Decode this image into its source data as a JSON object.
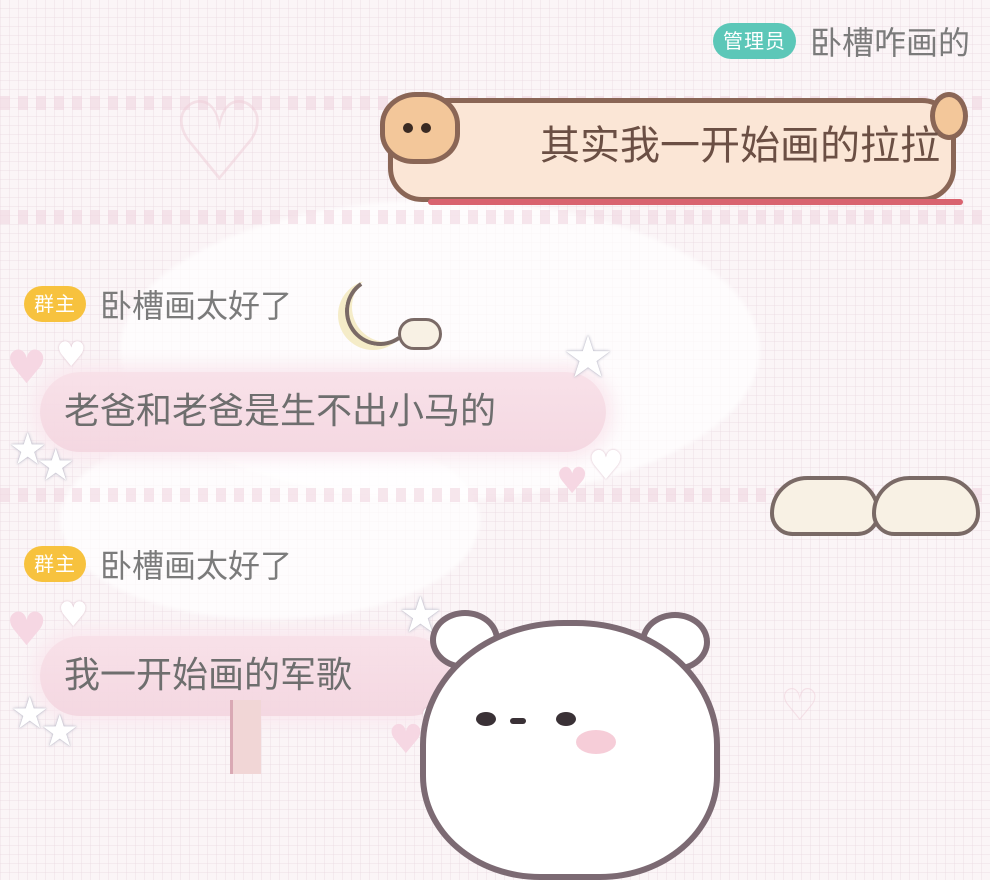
{
  "messages": [
    {
      "side": "right",
      "badge": "管理员",
      "sender": "卧槽咋画的",
      "text": "其实我一开始画的拉拉"
    },
    {
      "side": "left",
      "badge": "群主",
      "sender": "卧槽画太好了",
      "text": "老爸和老爸是生不出小马的"
    },
    {
      "side": "left",
      "badge": "群主",
      "sender": "卧槽画太好了",
      "text": "我一开始画的军歌"
    }
  ],
  "colors": {
    "admin_badge": "#5cc7b8",
    "owner_badge": "#f7c23e",
    "right_bubble": "#fbe6d6",
    "left_bubble": "#f6dbe5"
  },
  "decorations": [
    "star-icon",
    "heart-icon",
    "moon-icon",
    "cloud-icon",
    "bear-sticker"
  ]
}
